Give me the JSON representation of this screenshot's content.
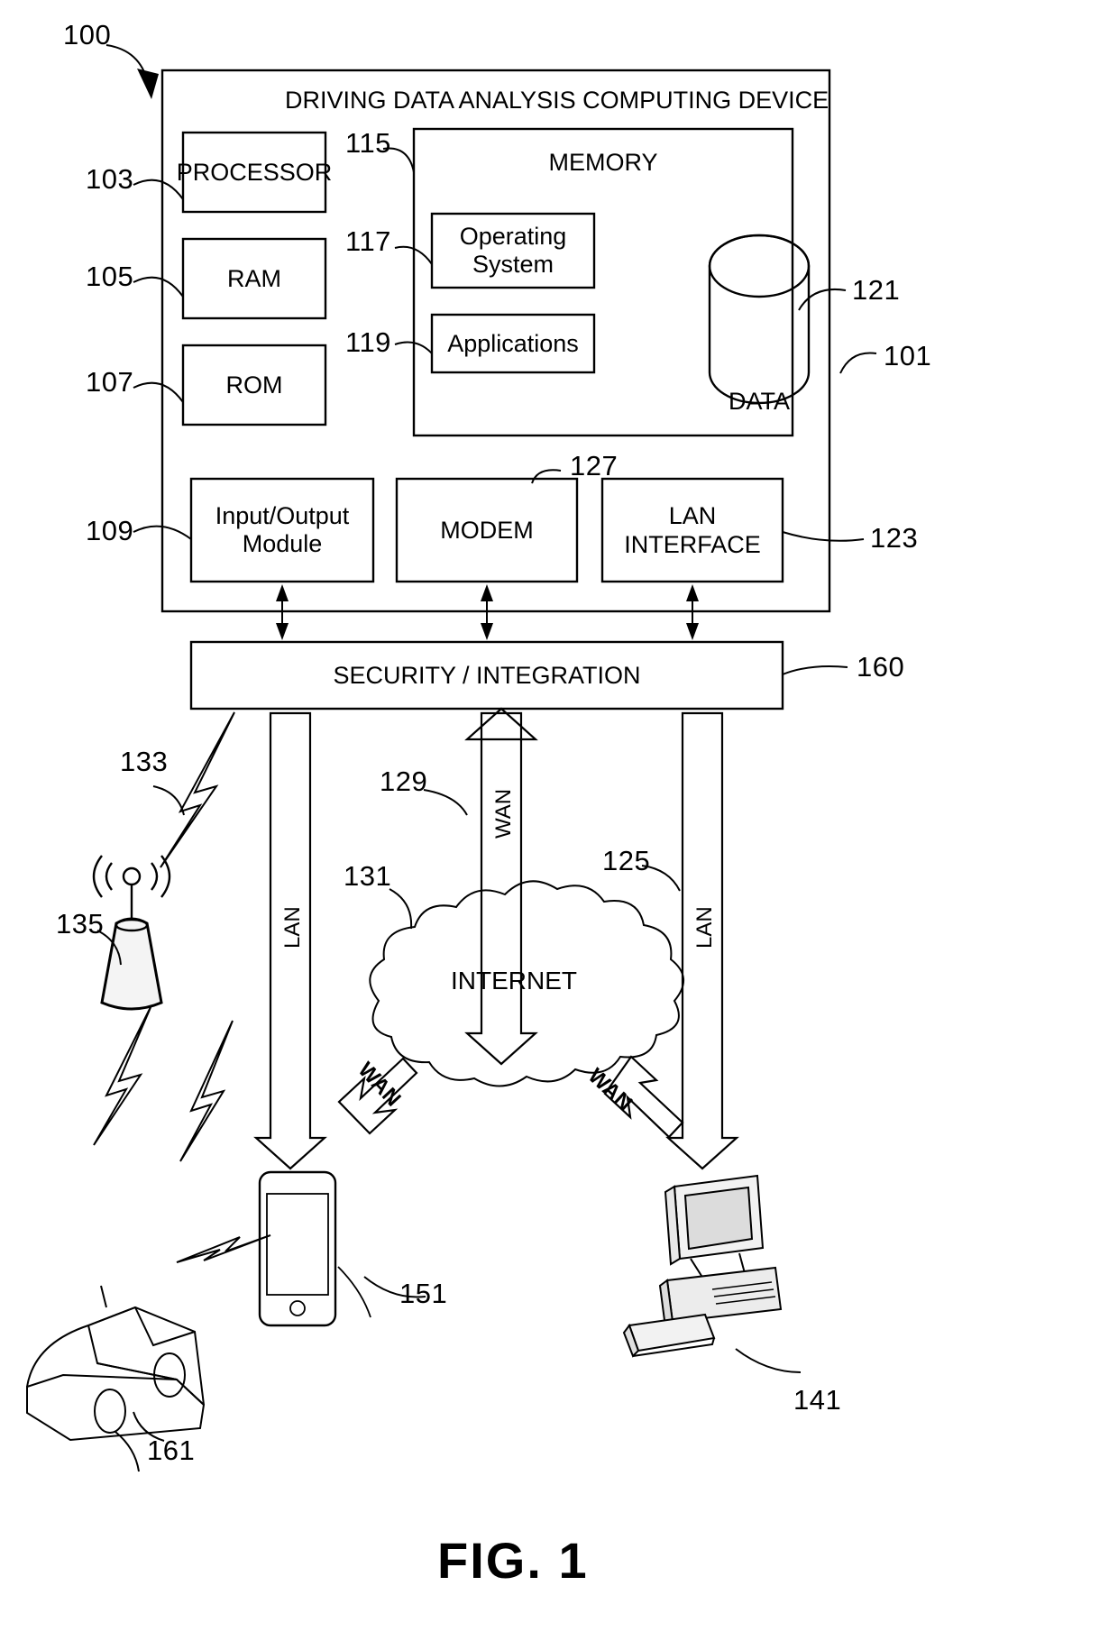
{
  "figure": {
    "caption": "FIG. 1",
    "system_ref": "100"
  },
  "device": {
    "title": "DRIVING DATA ANALYSIS COMPUTING DEVICE",
    "ref": "101",
    "components": [
      {
        "label": "PROCESSOR",
        "ref": "103"
      },
      {
        "label": "RAM",
        "ref": "105"
      },
      {
        "label": "ROM",
        "ref": "107"
      },
      {
        "label": "Input/Output Module",
        "ref": "109"
      },
      {
        "label": "MODEM",
        "ref": "127"
      },
      {
        "label": "LAN INTERFACE",
        "ref": "123"
      }
    ],
    "memory": {
      "label": "MEMORY",
      "ref": "115",
      "items": [
        {
          "label": "Operating System",
          "ref": "117"
        },
        {
          "label": "Applications",
          "ref": "119"
        }
      ],
      "data_store": {
        "label": "DATA",
        "ref": "121"
      }
    }
  },
  "security": {
    "label": "SECURITY / INTEGRATION",
    "ref": "160"
  },
  "network": {
    "lan_left_label": "LAN",
    "lan_left_ref": "133",
    "wan_center_label": "WAN",
    "wan_center_ref": "129",
    "lan_right_label": "LAN",
    "lan_right_ref": "125",
    "wan_phone_label": "WAN",
    "wan_workstation_label": "WAN",
    "internet": {
      "label": "INTERNET",
      "ref": "131"
    }
  },
  "endpoints": [
    {
      "name": "cell-tower",
      "ref": "135"
    },
    {
      "name": "vehicle",
      "ref": "161"
    },
    {
      "name": "mobile-phone",
      "ref": "151"
    },
    {
      "name": "workstation",
      "ref": "141"
    }
  ]
}
